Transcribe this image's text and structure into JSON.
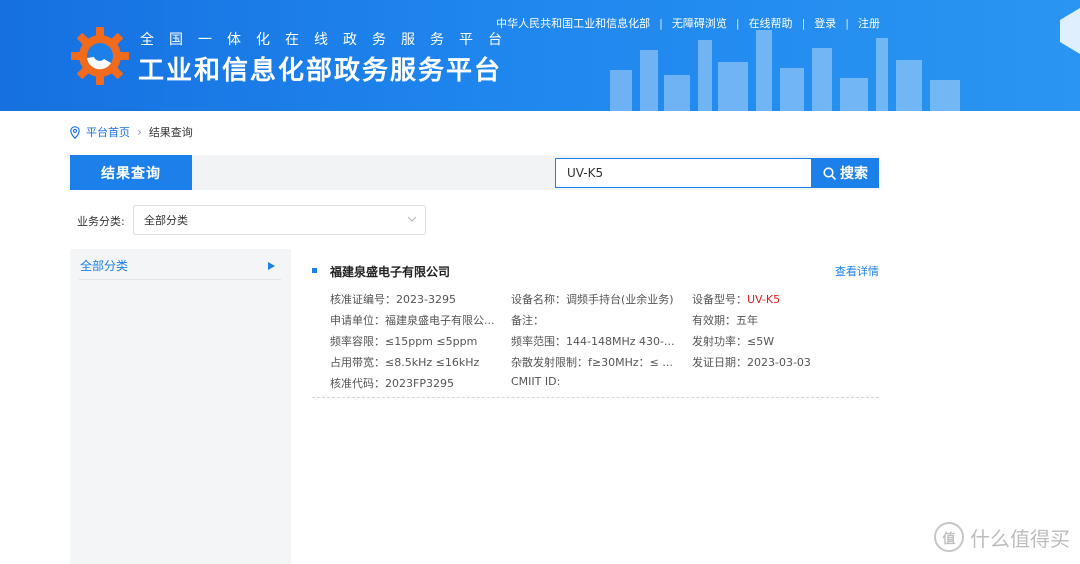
{
  "header": {
    "subtitle": "全国一体化在线政务服务平台",
    "title": "工业和信息化部政务服务平台",
    "top_links": [
      "中华人民共和国工业和信息化部",
      "无障碍浏览",
      "在线帮助",
      "登录",
      "注册"
    ],
    "logo_icon": "gear-logo-icon"
  },
  "breadcrumb": {
    "home": "平台首页",
    "separator": "›",
    "current": "结果查询"
  },
  "tabbar": {
    "active_tab": "结果查询",
    "search_value": "UV-K5",
    "search_button": "搜索"
  },
  "filter": {
    "label": "业务分类:",
    "selected": "全部分类"
  },
  "sidebar": {
    "items": [
      {
        "label": "全部分类",
        "active": true
      }
    ]
  },
  "result": {
    "company": "福建泉盛电子有限公司",
    "details_link": "查看详情",
    "fields": [
      {
        "key": "核准证编号：",
        "value": "2023-3295"
      },
      {
        "key": "设备名称：",
        "value": "调频手持台(业余业务)"
      },
      {
        "key": "设备型号：",
        "value": "UV-K5",
        "highlight": true
      },
      {
        "key": "申请单位：",
        "value": "福建泉盛电子有限公..."
      },
      {
        "key": "备注：",
        "value": ""
      },
      {
        "key": "有效期：",
        "value": "五年"
      },
      {
        "key": "频率容限：",
        "value": "≤15ppm ≤5ppm"
      },
      {
        "key": "频率范围：",
        "value": "144-148MHz 430-..."
      },
      {
        "key": "发射功率：",
        "value": "≤5W"
      },
      {
        "key": "占用带宽：",
        "value": "≤8.5kHz ≤16kHz"
      },
      {
        "key": "杂散发射限制：",
        "value": "f≥30MHz：≤ ..."
      },
      {
        "key": "发证日期：",
        "value": "2023-03-03"
      },
      {
        "key": "核准代码：",
        "value": "2023FP3295"
      },
      {
        "key": "CMIIT ID:",
        "value": ""
      }
    ]
  },
  "watermark": {
    "icon_text": "值",
    "text": "什么值得买"
  },
  "colors": {
    "primary": "#1c80ea",
    "highlight_red": "#e02020",
    "header_start": "#1670e0",
    "header_end": "#2a95f2"
  }
}
